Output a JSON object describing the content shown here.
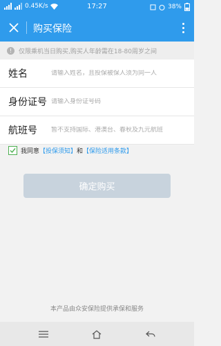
{
  "status_bar": {
    "network": "0.45K/s",
    "time": "17:27",
    "battery": "38%"
  },
  "app_bar": {
    "title": "购买保险"
  },
  "notice": {
    "text": "仅限乘机当日购买,购买人年龄需在18-80周岁之间"
  },
  "form": {
    "name": {
      "label": "姓名",
      "placeholder": "请输入姓名，且投保被保人须为同一人",
      "value": ""
    },
    "id_number": {
      "label": "身份证号",
      "placeholder": "请输入身份证号码",
      "value": ""
    },
    "flight_number": {
      "label": "航班号",
      "placeholder": "暂不支持国际、港澳台、春秋及九元航班",
      "value": ""
    }
  },
  "agreement": {
    "checked": true,
    "prefix": "我同意",
    "link1": "【投保须知】",
    "middle": "和",
    "link2": "【保险适用条款】"
  },
  "confirm_button": {
    "label": "确定购买"
  },
  "footer": {
    "text": "本产品由众安保险提供承保和服务"
  },
  "colors": {
    "primary": "#2f9bec",
    "button_disabled": "#c8d3dd",
    "check_green": "#4caf50"
  }
}
